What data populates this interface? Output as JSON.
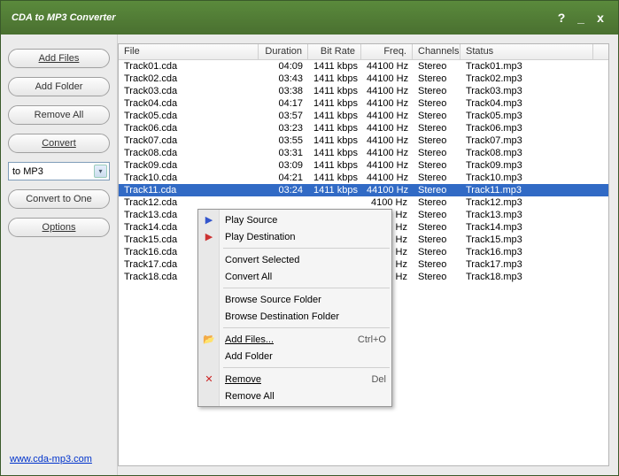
{
  "title": "CDA to MP3 Converter",
  "titlebar": {
    "help": "?",
    "min": "_",
    "close": "x"
  },
  "sidebar": {
    "add_files": "Add Files",
    "add_folder": "Add Folder",
    "remove_all": "Remove All",
    "convert": "Convert",
    "format_select": "to MP3",
    "convert_one": "Convert to One",
    "options": "Options",
    "link": "www.cda-mp3.com"
  },
  "columns": {
    "file": "File",
    "duration": "Duration",
    "bitrate": "Bit Rate",
    "freq": "Freq.",
    "channels": "Channels",
    "status": "Status"
  },
  "tracks": [
    {
      "file": "Track01.cda",
      "dur": "04:09",
      "br": "1411 kbps",
      "fr": "44100 Hz",
      "ch": "Stereo",
      "st": "Track01.mp3"
    },
    {
      "file": "Track02.cda",
      "dur": "03:43",
      "br": "1411 kbps",
      "fr": "44100 Hz",
      "ch": "Stereo",
      "st": "Track02.mp3"
    },
    {
      "file": "Track03.cda",
      "dur": "03:38",
      "br": "1411 kbps",
      "fr": "44100 Hz",
      "ch": "Stereo",
      "st": "Track03.mp3"
    },
    {
      "file": "Track04.cda",
      "dur": "04:17",
      "br": "1411 kbps",
      "fr": "44100 Hz",
      "ch": "Stereo",
      "st": "Track04.mp3"
    },
    {
      "file": "Track05.cda",
      "dur": "03:57",
      "br": "1411 kbps",
      "fr": "44100 Hz",
      "ch": "Stereo",
      "st": "Track05.mp3"
    },
    {
      "file": "Track06.cda",
      "dur": "03:23",
      "br": "1411 kbps",
      "fr": "44100 Hz",
      "ch": "Stereo",
      "st": "Track06.mp3"
    },
    {
      "file": "Track07.cda",
      "dur": "03:55",
      "br": "1411 kbps",
      "fr": "44100 Hz",
      "ch": "Stereo",
      "st": "Track07.mp3"
    },
    {
      "file": "Track08.cda",
      "dur": "03:31",
      "br": "1411 kbps",
      "fr": "44100 Hz",
      "ch": "Stereo",
      "st": "Track08.mp3"
    },
    {
      "file": "Track09.cda",
      "dur": "03:09",
      "br": "1411 kbps",
      "fr": "44100 Hz",
      "ch": "Stereo",
      "st": "Track09.mp3"
    },
    {
      "file": "Track10.cda",
      "dur": "04:21",
      "br": "1411 kbps",
      "fr": "44100 Hz",
      "ch": "Stereo",
      "st": "Track10.mp3"
    },
    {
      "file": "Track11.cda",
      "dur": "03:24",
      "br": "1411 kbps",
      "fr": "44100 Hz",
      "ch": "Stereo",
      "st": "Track11.mp3",
      "selected": true
    },
    {
      "file": "Track12.cda",
      "dur": "",
      "br": "",
      "fr": "4100 Hz",
      "ch": "Stereo",
      "st": "Track12.mp3"
    },
    {
      "file": "Track13.cda",
      "dur": "",
      "br": "",
      "fr": "4100 Hz",
      "ch": "Stereo",
      "st": "Track13.mp3"
    },
    {
      "file": "Track14.cda",
      "dur": "",
      "br": "",
      "fr": "4100 Hz",
      "ch": "Stereo",
      "st": "Track14.mp3"
    },
    {
      "file": "Track15.cda",
      "dur": "",
      "br": "",
      "fr": "4100 Hz",
      "ch": "Stereo",
      "st": "Track15.mp3"
    },
    {
      "file": "Track16.cda",
      "dur": "",
      "br": "",
      "fr": "4100 Hz",
      "ch": "Stereo",
      "st": "Track16.mp3"
    },
    {
      "file": "Track17.cda",
      "dur": "",
      "br": "",
      "fr": "4100 Hz",
      "ch": "Stereo",
      "st": "Track17.mp3"
    },
    {
      "file": "Track18.cda",
      "dur": "",
      "br": "",
      "fr": "4100 Hz",
      "ch": "Stereo",
      "st": "Track18.mp3"
    }
  ],
  "context": {
    "play_source": "Play Source",
    "play_dest": "Play Destination",
    "convert_selected": "Convert Selected",
    "convert_all": "Convert All",
    "browse_source": "Browse Source Folder",
    "browse_dest": "Browse Destination Folder",
    "add_files": "Add Files...",
    "add_files_sc": "Ctrl+O",
    "add_folder": "Add Folder",
    "remove": "Remove",
    "remove_sc": "Del",
    "remove_all": "Remove All"
  }
}
